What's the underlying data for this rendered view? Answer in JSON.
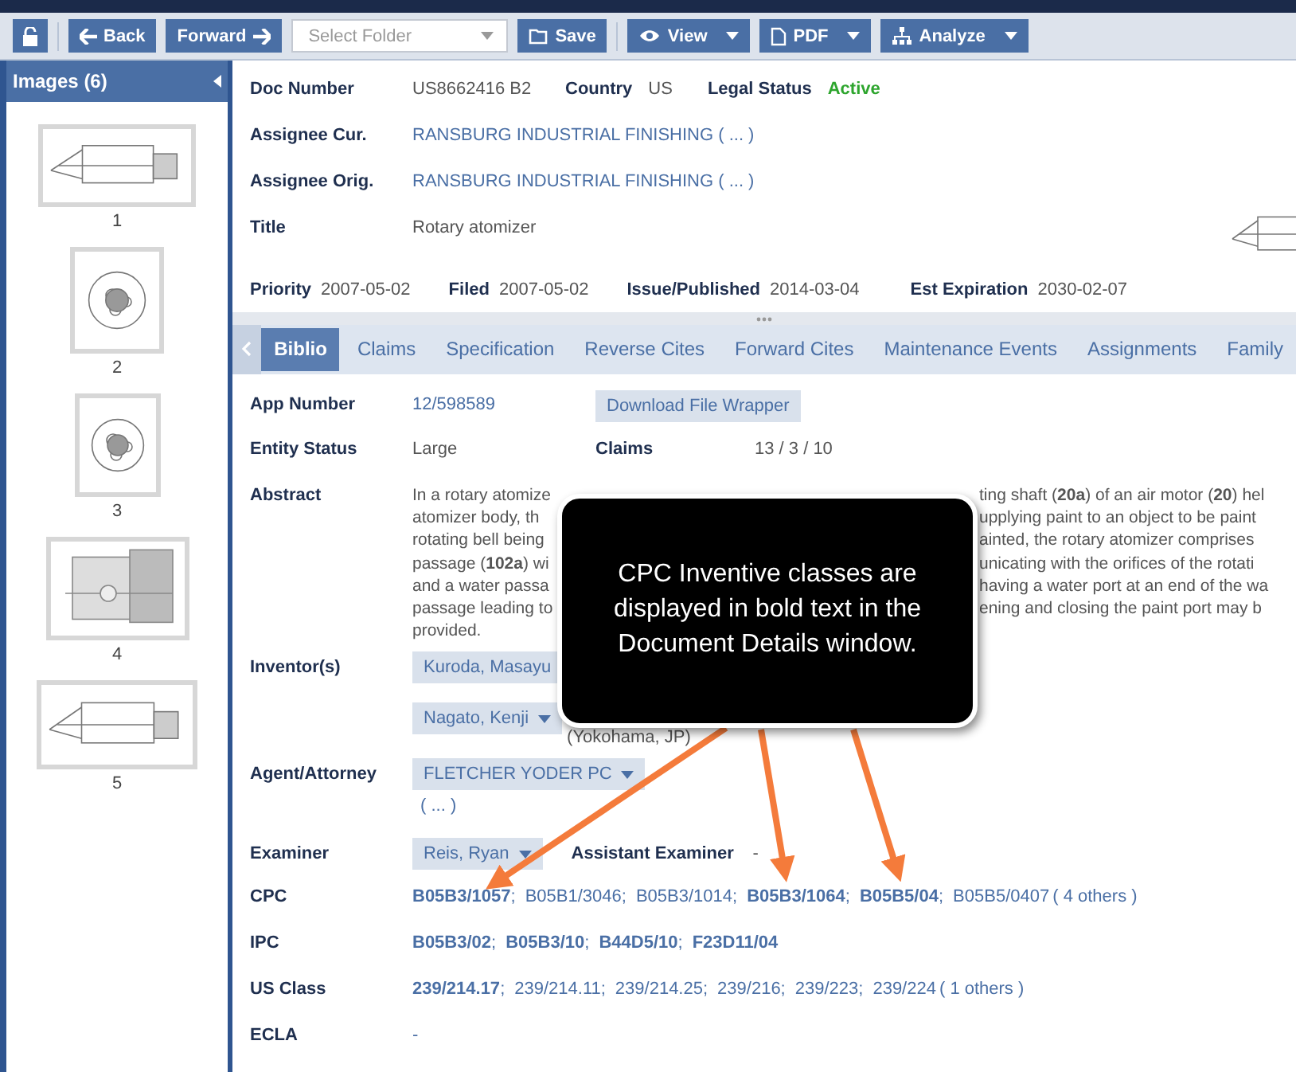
{
  "toolbar": {
    "back": "Back",
    "forward": "Forward",
    "folder_placeholder": "Select Folder",
    "save": "Save",
    "menus": [
      "View",
      "PDF",
      "Analyze"
    ]
  },
  "sidebar": {
    "title": "Images (6)",
    "images": [
      {
        "caption": "1",
        "kind": "picture"
      },
      {
        "caption": "2",
        "kind": "picture"
      },
      {
        "caption": "3",
        "kind": "picture"
      },
      {
        "caption": "4",
        "kind": "picture"
      },
      {
        "caption": "5",
        "kind": "picture"
      }
    ]
  },
  "header": {
    "rows": [
      [
        {
          "label": "Doc Number",
          "value": "US8662416 B2",
          "kind": "text"
        },
        {
          "label": "Country",
          "value": "US",
          "kind": "text"
        },
        {
          "label": "Legal Status",
          "value": "Active",
          "kind": "status"
        }
      ],
      [
        {
          "label": "Assignee Cur.",
          "value": "RANSBURG INDUSTRIAL FINISHING ( ... )",
          "kind": "link"
        }
      ],
      [
        {
          "label": "Assignee Orig.",
          "value": "RANSBURG INDUSTRIAL FINISHING ( ... )",
          "kind": "link"
        }
      ],
      [
        {
          "label": "Title",
          "value": "Rotary atomizer",
          "kind": "text"
        }
      ]
    ],
    "dates": [
      {
        "label": "Priority",
        "value": "2007-05-02"
      },
      {
        "label": "Filed",
        "value": "2007-05-02"
      },
      {
        "label": "Issue/Published",
        "value": "2014-03-04"
      },
      {
        "label": "Est Expiration",
        "value": "2030-02-07"
      }
    ]
  },
  "tabs": [
    {
      "label": "Biblio",
      "selected": true
    },
    {
      "label": "Claims",
      "selected": false
    },
    {
      "label": "Specification",
      "selected": false
    },
    {
      "label": "Reverse Cites",
      "selected": false
    },
    {
      "label": "Forward Cites",
      "selected": false
    },
    {
      "label": "Maintenance Events",
      "selected": false
    },
    {
      "label": "Assignments",
      "selected": false
    },
    {
      "label": "Family",
      "selected": false
    }
  ],
  "biblio": {
    "app_number": {
      "label": "App Number",
      "value": "12/598589",
      "button": "Download File Wrapper"
    },
    "entity_status": {
      "label": "Entity Status",
      "value": "Large",
      "claims_label": "Claims",
      "claims_value": "13 / 3 / 10"
    },
    "abstract": {
      "label": "Abstract",
      "lines": [
        {
          "left": "In a rotary atomize",
          "right": "ting shaft (**20a**) of an air motor (**20**) hel"
        },
        {
          "left": "atomizer body, th",
          "right": "upplying paint to an object to be paint"
        },
        {
          "left": "rotating bell being",
          "right": "ainted, the rotary atomizer comprises"
        },
        {
          "left": "passage (**102a**) wi",
          "right": "unicating with the orifices of the rotati"
        },
        {
          "left": "and a water passa",
          "right": "having a water port at an end of the wa"
        },
        {
          "left": "passage leading to",
          "right": "ening and closing the paint port may b"
        },
        {
          "left": "provided."
        }
      ]
    },
    "inventors": {
      "label": "Inventor(s)",
      "items": [
        {
          "name": "Kuroda, Masayu",
          "menu": false
        },
        {
          "name": "Nagato, Kenji",
          "menu": true,
          "location": "(Yokohama, JP)"
        }
      ]
    },
    "agent": {
      "label": "Agent/Attorney",
      "name": "FLETCHER YODER PC",
      "more": "( ... )"
    },
    "examiner": {
      "label": "Examiner",
      "name": "Reis, Ryan",
      "assistant_label": "Assistant Examiner",
      "assistant_value": "-"
    },
    "classes": [
      {
        "label": "CPC",
        "codes": [
          "**B05B3/1057**;",
          "B05B1/3046;",
          "B05B3/1014;",
          "**B05B3/1064**;",
          "**B05B5/04**;",
          "B05B5/0407"
        ],
        "more": "( 4 others )"
      },
      {
        "label": "IPC",
        "codes": [
          "**B05B3/02**;",
          "**B05B3/10**;",
          "**B44D5/10**;",
          "**F23D11/04**"
        ]
      },
      {
        "label": "US Class",
        "codes": [
          "**239/214.17**;",
          "239/214.11;",
          "239/214.25;",
          "239/216;",
          "239/223;",
          "239/224"
        ],
        "more": "( 1 others )"
      },
      {
        "label": "ECLA",
        "codes": [
          "-"
        ]
      }
    ]
  },
  "callout": {
    "text": "CPC Inventive classes are displayed in bold text in the Document Details window."
  }
}
